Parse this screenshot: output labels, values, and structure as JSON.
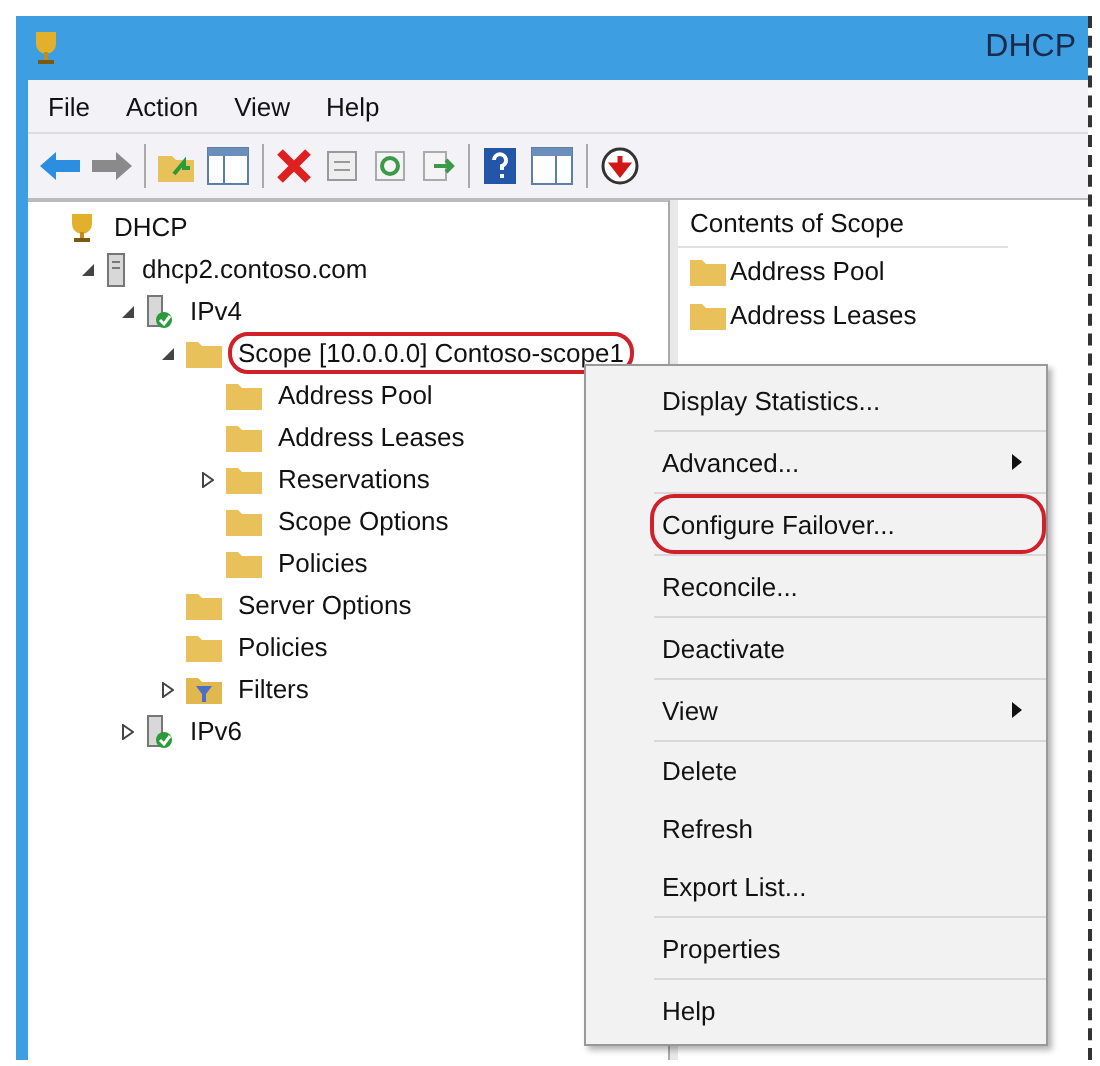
{
  "window": {
    "title": "DHCP"
  },
  "menu_bar": [
    "File",
    "Action",
    "View",
    "Help"
  ],
  "tree": [
    {
      "label": "DHCP",
      "kind": "root",
      "children": [
        {
          "label": "dhcp2.contoso.com",
          "kind": "server",
          "expanded": true,
          "children": [
            {
              "label": "IPv4",
              "kind": "protocol",
              "expanded": true,
              "children": [
                {
                  "label": "Scope [10.0.0.0] Contoso-scope1",
                  "kind": "folder",
                  "expanded": true,
                  "highlighted": true,
                  "children": [
                    {
                      "label": "Address Pool",
                      "kind": "folder"
                    },
                    {
                      "label": "Address Leases",
                      "kind": "folder"
                    },
                    {
                      "label": "Reservations",
                      "kind": "folder",
                      "expanded": false
                    },
                    {
                      "label": "Scope Options",
                      "kind": "folder"
                    },
                    {
                      "label": "Policies",
                      "kind": "folder"
                    }
                  ]
                },
                {
                  "label": "Server Options",
                  "kind": "folder"
                },
                {
                  "label": "Policies",
                  "kind": "folder"
                },
                {
                  "label": "Filters",
                  "kind": "filter",
                  "expanded": false
                }
              ]
            },
            {
              "label": "IPv6",
              "kind": "protocol",
              "expanded": false
            }
          ]
        }
      ]
    }
  ],
  "contents": {
    "header": "Contents of Scope",
    "items": [
      "Address Pool",
      "Address Leases"
    ]
  },
  "context_menu": [
    [
      {
        "label": "Display Statistics...",
        "submenu": false,
        "highlighted": false
      }
    ],
    [
      {
        "label": "Advanced...",
        "submenu": true,
        "highlighted": false
      }
    ],
    [
      {
        "label": "Configure Failover...",
        "submenu": false,
        "highlighted": true
      }
    ],
    [
      {
        "label": "Reconcile...",
        "submenu": false,
        "highlighted": false
      }
    ],
    [
      {
        "label": "Deactivate",
        "submenu": false,
        "highlighted": false
      }
    ],
    [
      {
        "label": "View",
        "submenu": true,
        "highlighted": false
      }
    ],
    [
      {
        "label": "Delete",
        "submenu": false,
        "highlighted": false
      },
      {
        "label": "Refresh",
        "submenu": false,
        "highlighted": false
      },
      {
        "label": "Export List...",
        "submenu": false,
        "highlighted": false
      }
    ],
    [
      {
        "label": "Properties",
        "submenu": false,
        "highlighted": false
      }
    ],
    [
      {
        "label": "Help",
        "submenu": false,
        "highlighted": false
      }
    ]
  ]
}
